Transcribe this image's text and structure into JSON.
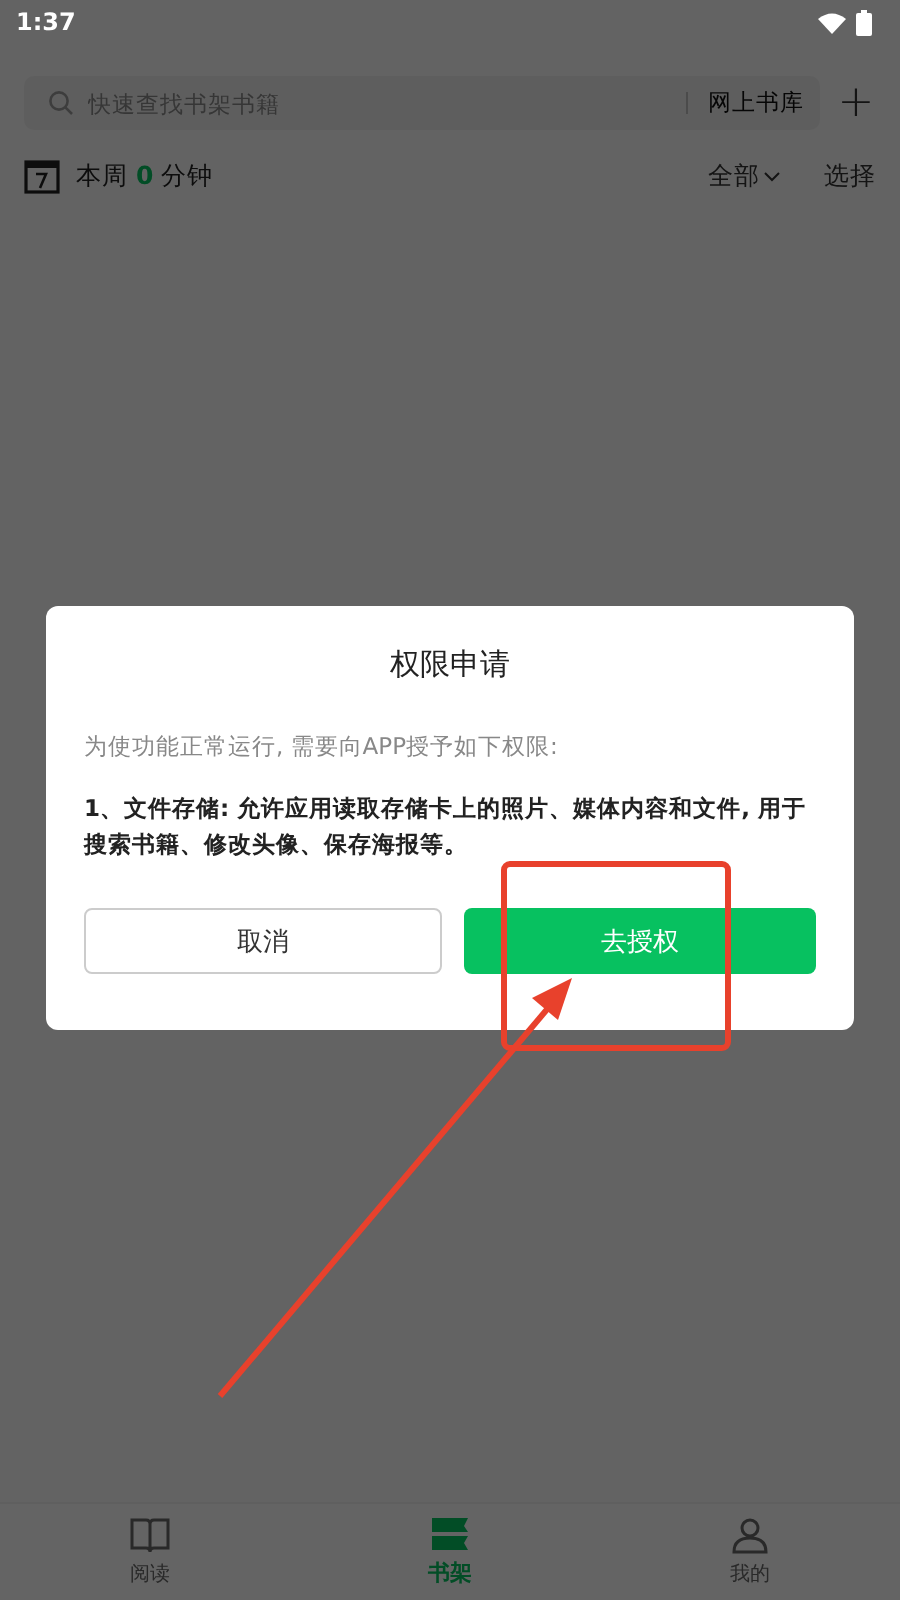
{
  "status_bar": {
    "time": "1:37"
  },
  "search": {
    "placeholder": "快速查找书架书籍",
    "library_link": "网上书库",
    "add": "+"
  },
  "stats": {
    "prefix": "本周",
    "minutes": "0",
    "suffix": "分钟",
    "filter": "全部",
    "select": "选择"
  },
  "dialog": {
    "title": "权限申请",
    "intro": "为使功能正常运行, 需要向APP授予如下权限:",
    "detail": "1、文件存储: 允许应用读取存储卡上的照片、媒体内容和文件, 用于搜索书籍、修改头像、保存海报等。",
    "buttons": [
      {
        "label": "取消",
        "kind": "secondary"
      },
      {
        "label": "去授权",
        "kind": "primary"
      }
    ]
  },
  "annotation": {
    "kind": "arrow-box"
  },
  "tabs": [
    {
      "label": "阅读",
      "kind": "book",
      "selected": false
    },
    {
      "label": "书架",
      "kind": "shelf",
      "selected": true
    },
    {
      "label": "我的",
      "kind": "person",
      "selected": false
    }
  ]
}
